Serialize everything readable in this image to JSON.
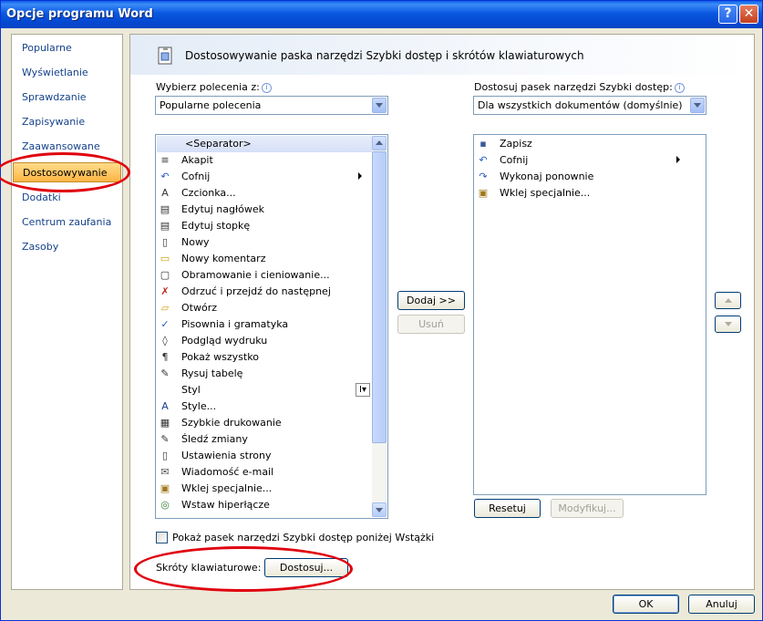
{
  "window": {
    "title": "Opcje programu Word",
    "help_glyph": "?",
    "close_glyph": "✕"
  },
  "sidebar": {
    "items": [
      {
        "label": "Popularne"
      },
      {
        "label": "Wyświetlanie"
      },
      {
        "label": "Sprawdzanie"
      },
      {
        "label": "Zapisywanie"
      },
      {
        "label": "Zaawansowane"
      },
      {
        "label": "Dostosowywanie",
        "selected": true
      },
      {
        "label": "Dodatki"
      },
      {
        "label": "Centrum zaufania"
      },
      {
        "label": "Zasoby"
      }
    ]
  },
  "header": {
    "title": "Dostosowywanie paska narzędzi Szybki dostęp i skrótów klawiaturowych"
  },
  "left_panel": {
    "choose_label": "Wybierz polecenia z:",
    "choose_value": "Popularne polecenia",
    "commands": [
      {
        "label": "<Separator>",
        "icon": "none",
        "selected": true
      },
      {
        "label": "Akapit",
        "icon": "paragraph-icon"
      },
      {
        "label": "Cofnij",
        "icon": "undo-icon",
        "submenu": true
      },
      {
        "label": "Czcionka...",
        "icon": "font-icon"
      },
      {
        "label": "Edytuj nagłówek",
        "icon": "header-icon"
      },
      {
        "label": "Edytuj stopkę",
        "icon": "footer-icon"
      },
      {
        "label": "Nowy",
        "icon": "new-document-icon"
      },
      {
        "label": "Nowy komentarz",
        "icon": "comment-icon"
      },
      {
        "label": "Obramowanie i cieniowanie...",
        "icon": "borders-icon"
      },
      {
        "label": "Odrzuć i przejdź do następnej",
        "icon": "reject-icon"
      },
      {
        "label": "Otwórz",
        "icon": "open-folder-icon"
      },
      {
        "label": "Pisownia i gramatyka",
        "icon": "spelling-icon"
      },
      {
        "label": "Podgląd wydruku",
        "icon": "print-preview-icon"
      },
      {
        "label": "Pokaż wszystko",
        "icon": "pilcrow-icon"
      },
      {
        "label": "Rysuj tabelę",
        "icon": "draw-table-icon"
      },
      {
        "label": "Styl",
        "icon": "none",
        "split": "I▾"
      },
      {
        "label": "Style...",
        "icon": "styles-icon"
      },
      {
        "label": "Szybkie drukowanie",
        "icon": "printer-icon"
      },
      {
        "label": "Śledź zmiany",
        "icon": "track-changes-icon"
      },
      {
        "label": "Ustawienia strony",
        "icon": "page-setup-icon"
      },
      {
        "label": "Wiadomość e-mail",
        "icon": "email-icon"
      },
      {
        "label": "Wklej specjalnie...",
        "icon": "paste-special-icon"
      },
      {
        "label": "Wstaw hiperłącze",
        "icon": "hyperlink-icon"
      }
    ]
  },
  "middle": {
    "add_label": "Dodaj >>",
    "remove_label": "Usuń"
  },
  "right_panel": {
    "customize_label": "Dostosuj pasek narzędzi Szybki dostęp:",
    "customize_value": "Dla wszystkich dokumentów (domyślnie)",
    "items": [
      {
        "label": "Zapisz",
        "icon": "save-icon"
      },
      {
        "label": "Cofnij",
        "icon": "undo-icon",
        "submenu": true
      },
      {
        "label": "Wykonaj ponownie",
        "icon": "redo-icon"
      },
      {
        "label": "Wklej specjalnie...",
        "icon": "paste-special-icon"
      }
    ],
    "reset_label": "Resetuj",
    "modify_label": "Modyfikuj..."
  },
  "options": {
    "show_below_ribbon_label": "Pokaż pasek narzędzi Szybki dostęp poniżej Wstążki",
    "show_below_ribbon_checked": false
  },
  "shortcuts": {
    "label": "Skróty klawiaturowe:",
    "button_label": "Dostosuj..."
  },
  "footer": {
    "ok_label": "OK",
    "cancel_label": "Anuluj"
  },
  "colors": {
    "annotation": "#e0000d",
    "selection": "#ffc55c",
    "title_bar": "#0a58e0"
  }
}
